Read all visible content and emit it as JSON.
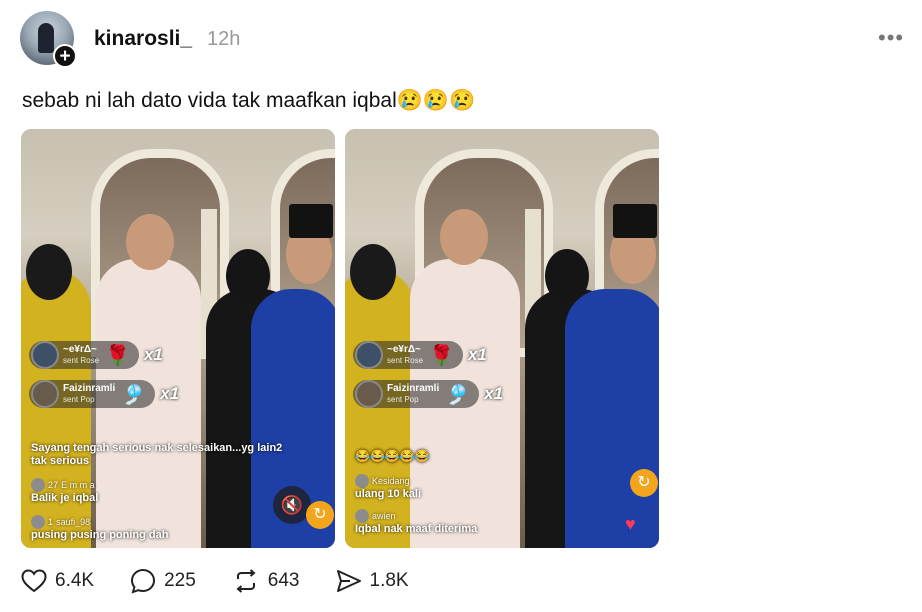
{
  "post": {
    "username": "kinarosli_",
    "time": "12h",
    "more_icon": "more-horizontal-icon",
    "caption": "sebab ni lah dato vida tak maafkan iqbal",
    "caption_emojis": "😢😢😢"
  },
  "video1": {
    "gifts": [
      {
        "name": "~e¥rΔ~",
        "sub": "sent Rose",
        "icon": "🌹",
        "count": "x1"
      },
      {
        "name": "Faizinramli",
        "sub": "sent Pop",
        "icon": "🎐",
        "count": "x1"
      }
    ],
    "comments": [
      {
        "text": "Sayang tengah serious nak selesaikan...yg lain2"
      },
      {
        "text": "tak serious"
      },
      {
        "badge": "27",
        "user": "E m m a",
        "text": "Balik je iqbal"
      },
      {
        "badge": "1",
        "user": "saufi_98",
        "text": "pusing pusing poning dah"
      }
    ],
    "mute_icon": "🔇",
    "share_icon": "↻"
  },
  "video2": {
    "gifts": [
      {
        "name": "~e¥rΔ~",
        "sub": "sent Rose",
        "icon": "🌹",
        "count": "x1"
      },
      {
        "name": "Faizinramli",
        "sub": "sent Pop",
        "icon": "🎐",
        "count": "x1"
      }
    ],
    "comments": [
      {
        "text": "😂😂😂😂😂"
      },
      {
        "user": "Kesidang",
        "text": "ulang 10 kali"
      },
      {
        "user": "awien",
        "text": "Iqbal nak maaf diterima"
      }
    ]
  },
  "actions": {
    "likes": "6.4K",
    "comments": "225",
    "reposts": "643",
    "shares": "1.8K"
  }
}
